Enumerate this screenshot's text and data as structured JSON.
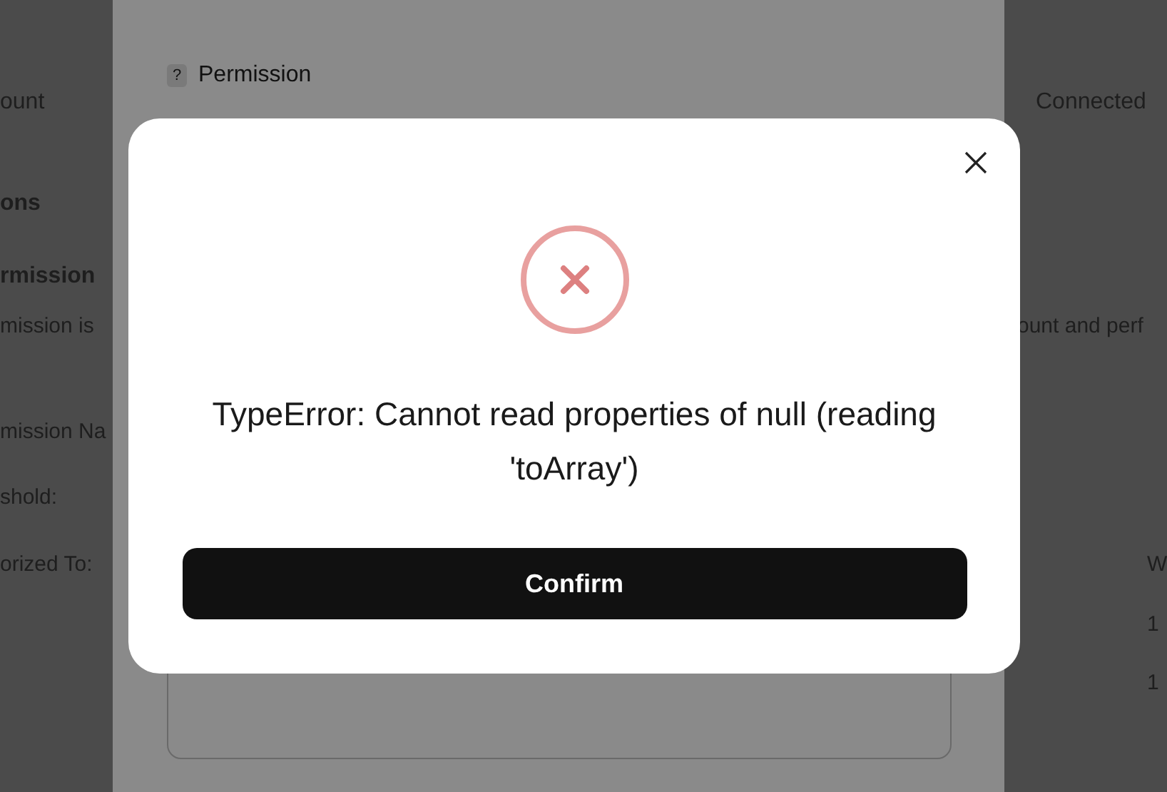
{
  "page_left": {
    "texts": [
      {
        "text": "ount",
        "kind": "heading"
      },
      {
        "text": "ons",
        "kind": "section"
      },
      {
        "text": "rmission",
        "kind": "section"
      },
      {
        "text": "mission is",
        "kind": "body"
      },
      {
        "text": "mission Na",
        "kind": "label"
      },
      {
        "text": "shold:",
        "kind": "label"
      },
      {
        "text": "orized To:",
        "kind": "label"
      }
    ]
  },
  "page_right": {
    "texts": [
      {
        "text": "Connected",
        "kind": "heading"
      },
      {
        "text": "ount and perf",
        "kind": "body"
      },
      {
        "text": "W",
        "kind": "column"
      },
      {
        "text": "1",
        "kind": "cell"
      },
      {
        "text": "1",
        "kind": "cell"
      }
    ]
  },
  "panel": {
    "help_glyph": "?",
    "title": "Permission"
  },
  "dialog": {
    "message": "TypeError: Cannot read properties of null (reading 'toArray')",
    "button": "Confirm"
  }
}
